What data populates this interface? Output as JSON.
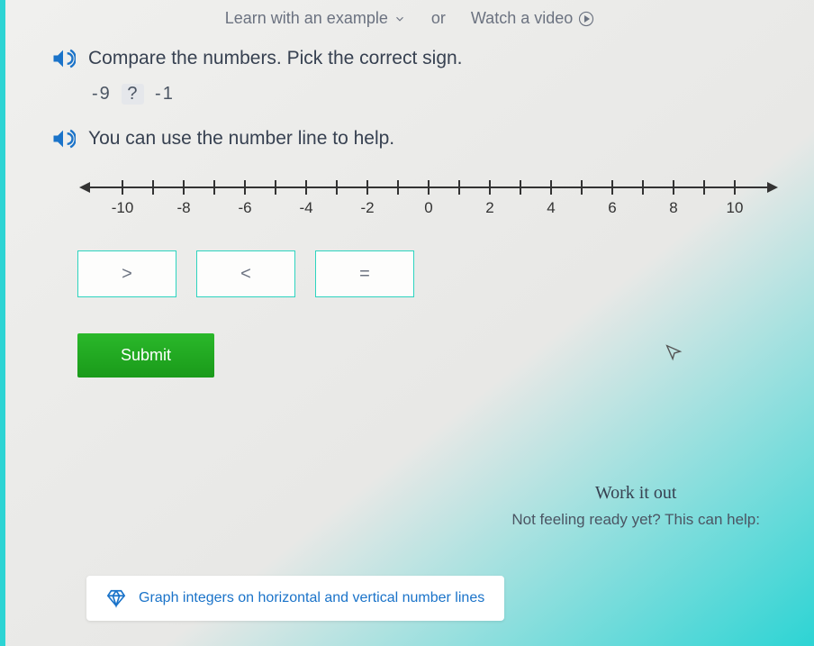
{
  "top": {
    "learn": "Learn with an example",
    "or": "or",
    "watch": "Watch a video"
  },
  "q1": "Compare the numbers. Pick the correct sign.",
  "expr": {
    "left": "-9",
    "mid": "?",
    "right": "-1"
  },
  "q2": "You can use the number line to help.",
  "ticks": [
    "-10",
    "-8",
    "-6",
    "-4",
    "-2",
    "0",
    "2",
    "4",
    "6",
    "8",
    "10"
  ],
  "answers": {
    "gt": ">",
    "lt": "<",
    "eq": "="
  },
  "submit": "Submit",
  "work": {
    "title": "Work it out",
    "sub": "Not feeling ready yet? This can help:"
  },
  "help": "Graph integers on horizontal and vertical number lines"
}
